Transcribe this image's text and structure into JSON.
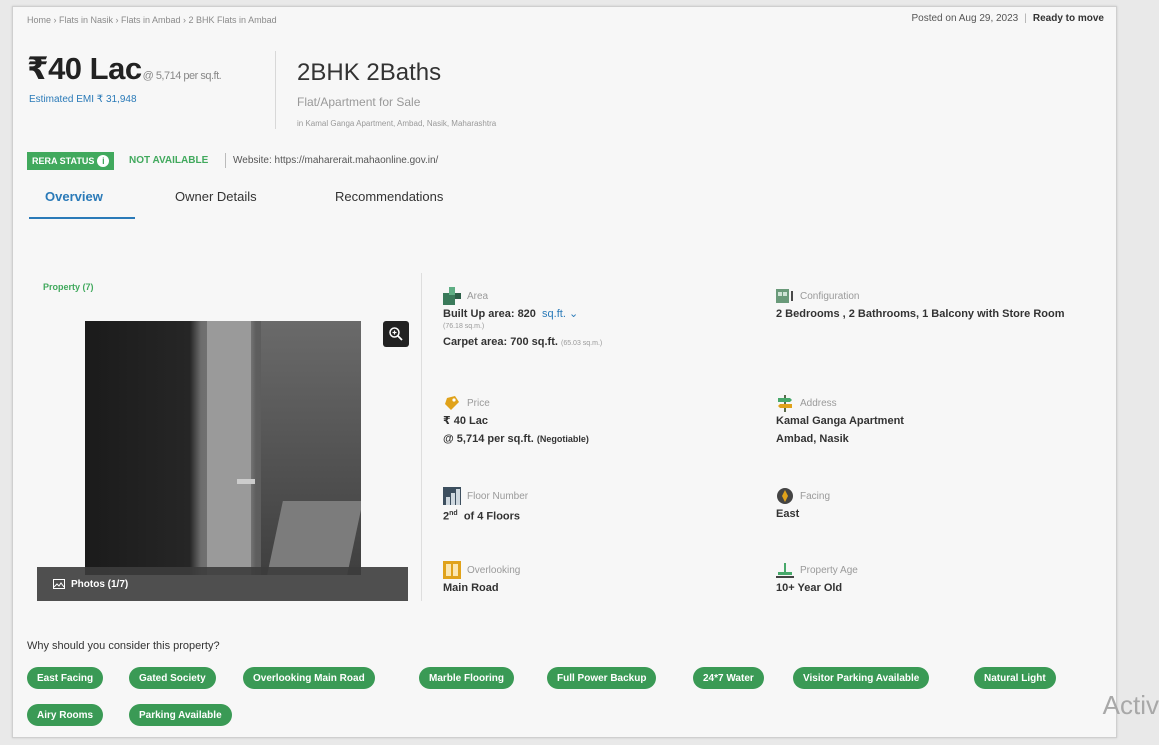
{
  "breadcrumb": "Home › Flats in Nasik › Flats in Ambad › 2 BHK Flats in Ambad",
  "posted": "Posted on Aug 29, 2023",
  "ready": "Ready to move",
  "price": {
    "main": "₹40 Lac",
    "rate": "@ 5,714 per sq.ft.",
    "emi": "Estimated EMI ₹ 31,948"
  },
  "title": "2BHK 2Baths",
  "subtitle": "Flat/Apartment for Sale",
  "location": "in Kamal Ganga Apartment, Ambad, Nasik, Maharashtra",
  "rera": {
    "badge": "RERA STATUS",
    "status": "NOT AVAILABLE",
    "website_label": "Website:",
    "website": "https://maharerait.mahaonline.gov.in/"
  },
  "tabs": [
    "Overview",
    "Owner Details",
    "Recommendations"
  ],
  "property_label": "Property (7)",
  "photos_label": "Photos (1/7)",
  "details": {
    "area": {
      "label": "Area",
      "built_up": "Built Up area: 820",
      "unit": "sq.ft.",
      "built_up_sqm": "(76.18 sq.m.)",
      "carpet": "Carpet area: 700 sq.ft.",
      "carpet_sqm": "(65.03 sq.m.)"
    },
    "configuration": {
      "label": "Configuration",
      "value": "2 Bedrooms , 2 Bathrooms, 1 Balcony with Store Room"
    },
    "price": {
      "label": "Price",
      "value": "₹ 40 Lac",
      "rate": "@ 5,714 per sq.ft.",
      "negotiable": "(Negotiable)"
    },
    "address": {
      "label": "Address",
      "line1": "Kamal Ganga Apartment",
      "line2": "Ambad, Nasik"
    },
    "floor": {
      "label": "Floor Number",
      "value": "2",
      "sup": "nd",
      "of": "of 4 Floors"
    },
    "facing": {
      "label": "Facing",
      "value": "East"
    },
    "overlooking": {
      "label": "Overlooking",
      "value": "Main Road"
    },
    "age": {
      "label": "Property Age",
      "value": "10+ Year Old"
    }
  },
  "why_title": "Why should you consider this property?",
  "chips": [
    "East Facing",
    "Gated Society",
    "Overlooking Main Road",
    "Marble Flooring",
    "Full Power Backup",
    "24*7 Water",
    "Visitor Parking Available",
    "Natural Light",
    "Airy Rooms",
    "Parking Available"
  ],
  "watermark": "Activ",
  "colors": {
    "accent_blue": "#2a7ab8",
    "green": "#41a95d",
    "chip_green": "#3a9a55"
  },
  "icons": [
    "info-icon",
    "zoom-icon",
    "photo-icon",
    "area-icon",
    "configuration-icon",
    "price-icon",
    "address-icon",
    "floor-icon",
    "facing-icon",
    "overlooking-icon",
    "age-icon",
    "chevron-down-icon"
  ]
}
